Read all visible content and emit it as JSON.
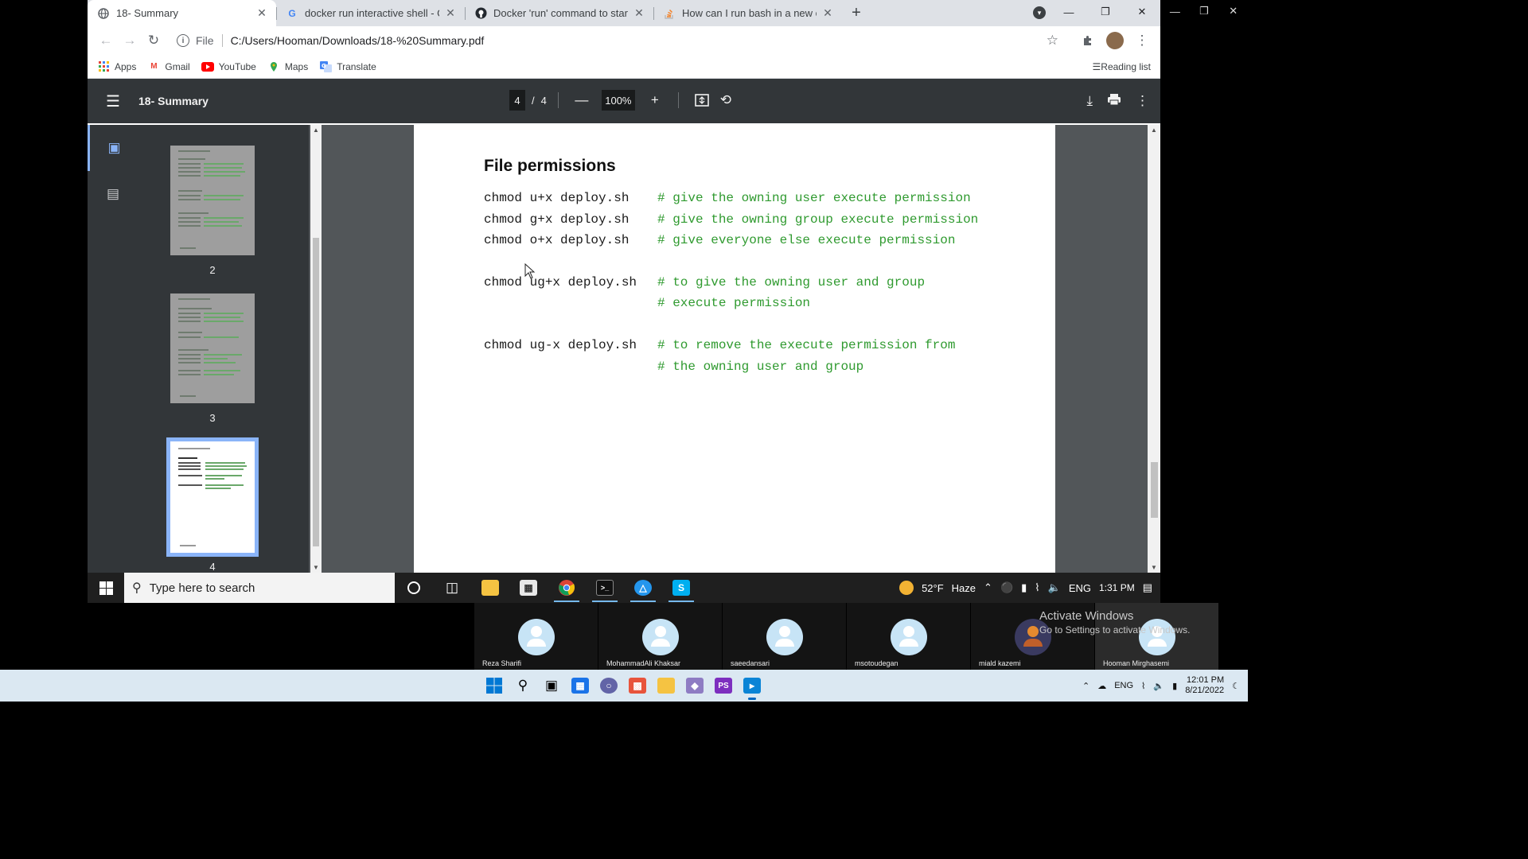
{
  "browser": {
    "tabs": [
      {
        "title": "18- Summary",
        "icon": "globe-icon",
        "active": true
      },
      {
        "title": "docker run interactive shell - Goo",
        "icon": "google-icon",
        "active": false
      },
      {
        "title": "Docker 'run' command to start an",
        "icon": "github-icon",
        "active": false
      },
      {
        "title": "How can I run bash in a new cont",
        "icon": "stackoverflow-icon",
        "active": false
      }
    ],
    "address": {
      "scheme": "File",
      "url": "C:/Users/Hooman/Downloads/18-%20Summary.pdf"
    },
    "bookmarks": [
      {
        "label": "Apps",
        "icon": "apps-grid-icon"
      },
      {
        "label": "Gmail",
        "icon": "gmail-icon"
      },
      {
        "label": "YouTube",
        "icon": "youtube-icon"
      },
      {
        "label": "Maps",
        "icon": "maps-icon"
      },
      {
        "label": "Translate",
        "icon": "translate-icon"
      }
    ],
    "reading_list": "Reading list"
  },
  "pdf": {
    "title": "18- Summary",
    "page_current": "4",
    "page_separator": "/",
    "page_total": "4",
    "zoom": "100%",
    "thumbnails": [
      {
        "label": "2"
      },
      {
        "label": "3"
      },
      {
        "label": "4"
      }
    ],
    "page": {
      "heading": "File permissions",
      "lines": [
        {
          "code": "chmod u+x deploy.sh",
          "comment": "# give the owning user execute permission"
        },
        {
          "code": "chmod g+x deploy.sh",
          "comment": "# give the owning group execute permission"
        },
        {
          "code": "chmod o+x deploy.sh",
          "comment": "# give everyone else execute permission"
        },
        {
          "code": "chmod ug+x deploy.sh",
          "comment": "# to give the owning user and group"
        },
        {
          "code": "",
          "comment": "# execute permission"
        },
        {
          "code": "chmod ug-x deploy.sh",
          "comment": "# to remove the execute permission from"
        },
        {
          "code": "",
          "comment": "# the owning user and group"
        }
      ]
    }
  },
  "taskbar": {
    "search_placeholder": "Type here to search",
    "weather": "52°F",
    "weather_desc": "Haze",
    "lang": "ENG",
    "time": "1:31 PM"
  },
  "participants": [
    {
      "name": "Reza Sharifi"
    },
    {
      "name": "MohammadAli Khaksar"
    },
    {
      "name": "saeedansari"
    },
    {
      "name": "msotoudegan"
    },
    {
      "name": "miald kazemi"
    },
    {
      "name": "Hooman Mirghasemi"
    }
  ],
  "activation": {
    "title": "Activate Windows",
    "subtitle": "Go to Settings to activate Windows."
  },
  "outer_taskbar": {
    "lang": "ENG",
    "time": "12:01 PM",
    "date": "8/21/2022"
  },
  "colors": {
    "accent": "#8ab4f8",
    "code_comment": "#2f9a2f",
    "pdf_toolbar": "#323639"
  }
}
